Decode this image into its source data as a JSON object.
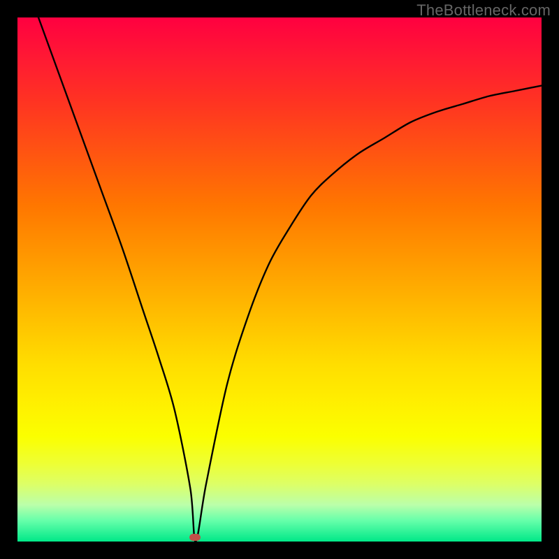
{
  "watermark": "TheBottleneck.com",
  "chart_data": {
    "type": "line",
    "title": "",
    "xlabel": "",
    "ylabel": "",
    "xlim": [
      0,
      100
    ],
    "ylim": [
      0,
      100
    ],
    "series": [
      {
        "name": "curve",
        "x": [
          4,
          8,
          12,
          16,
          20,
          24,
          27,
          30,
          33,
          34,
          36,
          40,
          44,
          48,
          52,
          56,
          60,
          65,
          70,
          75,
          80,
          85,
          90,
          95,
          100
        ],
        "y": [
          100,
          89,
          78,
          67,
          56,
          44,
          35,
          25,
          10,
          0,
          11,
          30,
          43,
          53,
          60,
          66,
          70,
          74,
          77,
          80,
          82,
          83.5,
          85,
          86,
          87
        ]
      }
    ],
    "marker": {
      "x": 33.8,
      "y": 0.8
    },
    "background": {
      "gradient_direction": "vertical",
      "stops": [
        {
          "pos": 0.0,
          "color": "#ff0040"
        },
        {
          "pos": 0.5,
          "color": "#ffaa00"
        },
        {
          "pos": 0.8,
          "color": "#f5ff00"
        },
        {
          "pos": 1.0,
          "color": "#00e888"
        }
      ]
    }
  }
}
